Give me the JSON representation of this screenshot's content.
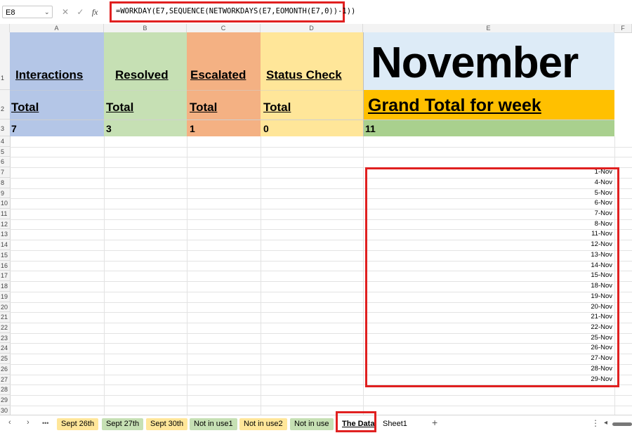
{
  "formula_bar": {
    "name_box": "E8",
    "cancel_icon": "✕",
    "confirm_icon": "✓",
    "fx_label": "fx",
    "formula": "=WORKDAY(E7,SEQUENCE(NETWORKDAYS(E7,EOMONTH(E7,0))-1))"
  },
  "columns": [
    "A",
    "B",
    "C",
    "D",
    "E",
    "F"
  ],
  "rows": [
    "1",
    "2",
    "3",
    "4",
    "5",
    "6",
    "7",
    "8",
    "9",
    "10",
    "11",
    "12",
    "13",
    "14",
    "15",
    "16",
    "17",
    "18",
    "19",
    "20",
    "21",
    "22",
    "23",
    "24",
    "25",
    "26",
    "27",
    "28",
    "29",
    "30"
  ],
  "header_row": {
    "a1": "Interactions",
    "b1": "Resolved",
    "c1": "Escalated",
    "d1": "Status Check",
    "e1": "November",
    "a2": "Total",
    "b2": "Total",
    "c2": "Total",
    "d2": "Total",
    "e2": "Grand Total for week",
    "a3": "7",
    "b3": "3",
    "c3": "1",
    "d3": "0",
    "e3": "11"
  },
  "dates": [
    "1-Nov",
    "4-Nov",
    "5-Nov",
    "6-Nov",
    "7-Nov",
    "8-Nov",
    "11-Nov",
    "12-Nov",
    "13-Nov",
    "14-Nov",
    "15-Nov",
    "18-Nov",
    "19-Nov",
    "20-Nov",
    "21-Nov",
    "22-Nov",
    "25-Nov",
    "26-Nov",
    "27-Nov",
    "28-Nov",
    "29-Nov"
  ],
  "colors": {
    "interactions": "#b4c6e7",
    "resolved": "#c6e0b4",
    "escalated": "#f4b183",
    "status": "#ffe699",
    "month_bg": "#ddebf7",
    "grand_bg": "#ffc000",
    "e3_bg": "#a9d08e",
    "highlight": "#e02020"
  },
  "tabs": {
    "more": "•••",
    "items": [
      {
        "label": "Sept 26th",
        "color": "#ffe699"
      },
      {
        "label": "Sept 27th",
        "color": "#c6e0b4"
      },
      {
        "label": "Sept 30th",
        "color": "#ffe699"
      },
      {
        "label": "Not in use1",
        "color": "#c6e0b4"
      },
      {
        "label": "Not in use2",
        "color": "#ffe699"
      },
      {
        "label": "Not in use",
        "color": "#c6e0b4"
      },
      {
        "label": "The Data",
        "color": "#ffffff"
      },
      {
        "label": "Sheet1",
        "color": "#ffffff"
      }
    ],
    "add": "+"
  }
}
